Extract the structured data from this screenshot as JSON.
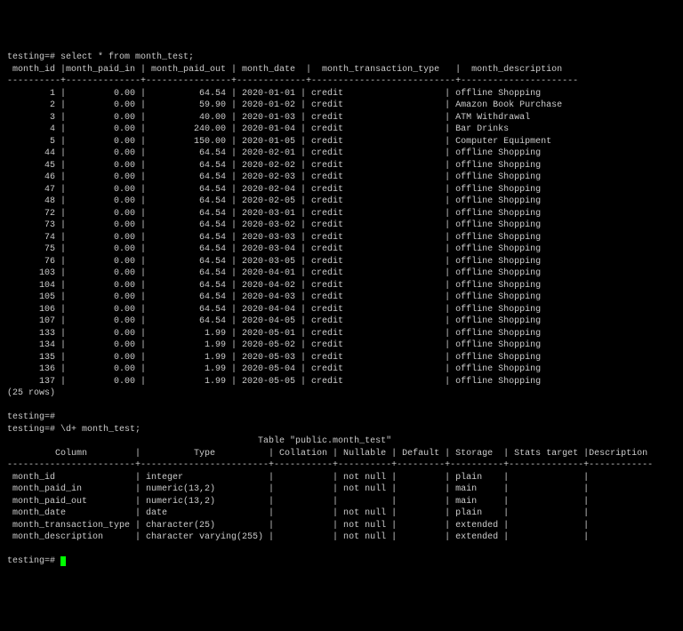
{
  "prompt": "testing=#",
  "query1": "select * from month_test;",
  "query2": "\\d+ month_test;",
  "headers": [
    "month_id",
    "month_paid_in",
    "month_paid_out",
    "month_date",
    "month_transaction_type",
    "month_description"
  ],
  "rows": [
    {
      "id": 1,
      "in": "0.00",
      "out": "64.54",
      "date": "2020-01-01",
      "type": "credit",
      "desc": "offline Shopping"
    },
    {
      "id": 2,
      "in": "0.00",
      "out": "59.90",
      "date": "2020-01-02",
      "type": "credit",
      "desc": "Amazon Book Purchase"
    },
    {
      "id": 3,
      "in": "0.00",
      "out": "40.00",
      "date": "2020-01-03",
      "type": "credit",
      "desc": "ATM Withdrawal"
    },
    {
      "id": 4,
      "in": "0.00",
      "out": "240.00",
      "date": "2020-01-04",
      "type": "credit",
      "desc": "Bar Drinks"
    },
    {
      "id": 5,
      "in": "0.00",
      "out": "150.00",
      "date": "2020-01-05",
      "type": "credit",
      "desc": "Computer Equipment"
    },
    {
      "id": 44,
      "in": "0.00",
      "out": "64.54",
      "date": "2020-02-01",
      "type": "credit",
      "desc": "offline Shopping"
    },
    {
      "id": 45,
      "in": "0.00",
      "out": "64.54",
      "date": "2020-02-02",
      "type": "credit",
      "desc": "offline Shopping"
    },
    {
      "id": 46,
      "in": "0.00",
      "out": "64.54",
      "date": "2020-02-03",
      "type": "credit",
      "desc": "offline Shopping"
    },
    {
      "id": 47,
      "in": "0.00",
      "out": "64.54",
      "date": "2020-02-04",
      "type": "credit",
      "desc": "offline Shopping"
    },
    {
      "id": 48,
      "in": "0.00",
      "out": "64.54",
      "date": "2020-02-05",
      "type": "credit",
      "desc": "offline Shopping"
    },
    {
      "id": 72,
      "in": "0.00",
      "out": "64.54",
      "date": "2020-03-01",
      "type": "credit",
      "desc": "offline Shopping"
    },
    {
      "id": 73,
      "in": "0.00",
      "out": "64.54",
      "date": "2020-03-02",
      "type": "credit",
      "desc": "offline Shopping"
    },
    {
      "id": 74,
      "in": "0.00",
      "out": "64.54",
      "date": "2020-03-03",
      "type": "credit",
      "desc": "offline Shopping"
    },
    {
      "id": 75,
      "in": "0.00",
      "out": "64.54",
      "date": "2020-03-04",
      "type": "credit",
      "desc": "offline Shopping"
    },
    {
      "id": 76,
      "in": "0.00",
      "out": "64.54",
      "date": "2020-03-05",
      "type": "credit",
      "desc": "offline Shopping"
    },
    {
      "id": 103,
      "in": "0.00",
      "out": "64.54",
      "date": "2020-04-01",
      "type": "credit",
      "desc": "offline Shopping"
    },
    {
      "id": 104,
      "in": "0.00",
      "out": "64.54",
      "date": "2020-04-02",
      "type": "credit",
      "desc": "offline Shopping"
    },
    {
      "id": 105,
      "in": "0.00",
      "out": "64.54",
      "date": "2020-04-03",
      "type": "credit",
      "desc": "offline Shopping"
    },
    {
      "id": 106,
      "in": "0.00",
      "out": "64.54",
      "date": "2020-04-04",
      "type": "credit",
      "desc": "offline Shopping"
    },
    {
      "id": 107,
      "in": "0.00",
      "out": "64.54",
      "date": "2020-04-05",
      "type": "credit",
      "desc": "offline Shopping"
    },
    {
      "id": 133,
      "in": "0.00",
      "out": "1.99",
      "date": "2020-05-01",
      "type": "credit",
      "desc": "offline Shopping"
    },
    {
      "id": 134,
      "in": "0.00",
      "out": "1.99",
      "date": "2020-05-02",
      "type": "credit",
      "desc": "offline Shopping"
    },
    {
      "id": 135,
      "in": "0.00",
      "out": "1.99",
      "date": "2020-05-03",
      "type": "credit",
      "desc": "offline Shopping"
    },
    {
      "id": 136,
      "in": "0.00",
      "out": "1.99",
      "date": "2020-05-04",
      "type": "credit",
      "desc": "offline Shopping"
    },
    {
      "id": 137,
      "in": "0.00",
      "out": "1.99",
      "date": "2020-05-05",
      "type": "credit",
      "desc": "offline Shopping"
    }
  ],
  "rowcount": "(25 rows)",
  "table_title": "Table \"public.month_test\"",
  "schema_headers": [
    "Column",
    "Type",
    "Collation",
    "Nullable",
    "Default",
    "Storage",
    "Stats target",
    "Description"
  ],
  "schema": [
    {
      "col": "month_id",
      "type": "integer",
      "coll": "",
      "null": "not null",
      "def": "",
      "stor": "plain",
      "stats": "",
      "desc": ""
    },
    {
      "col": "month_paid_in",
      "type": "numeric(13,2)",
      "coll": "",
      "null": "not null",
      "def": "",
      "stor": "main",
      "stats": "",
      "desc": ""
    },
    {
      "col": "month_paid_out",
      "type": "numeric(13,2)",
      "coll": "",
      "null": "",
      "def": "",
      "stor": "main",
      "stats": "",
      "desc": ""
    },
    {
      "col": "month_date",
      "type": "date",
      "coll": "",
      "null": "not null",
      "def": "",
      "stor": "plain",
      "stats": "",
      "desc": ""
    },
    {
      "col": "month_transaction_type",
      "type": "character(25)",
      "coll": "",
      "null": "not null",
      "def": "",
      "stor": "extended",
      "stats": "",
      "desc": ""
    },
    {
      "col": "month_description",
      "type": "character varying(255)",
      "coll": "",
      "null": "not null",
      "def": "",
      "stor": "extended",
      "stats": "",
      "desc": ""
    }
  ]
}
